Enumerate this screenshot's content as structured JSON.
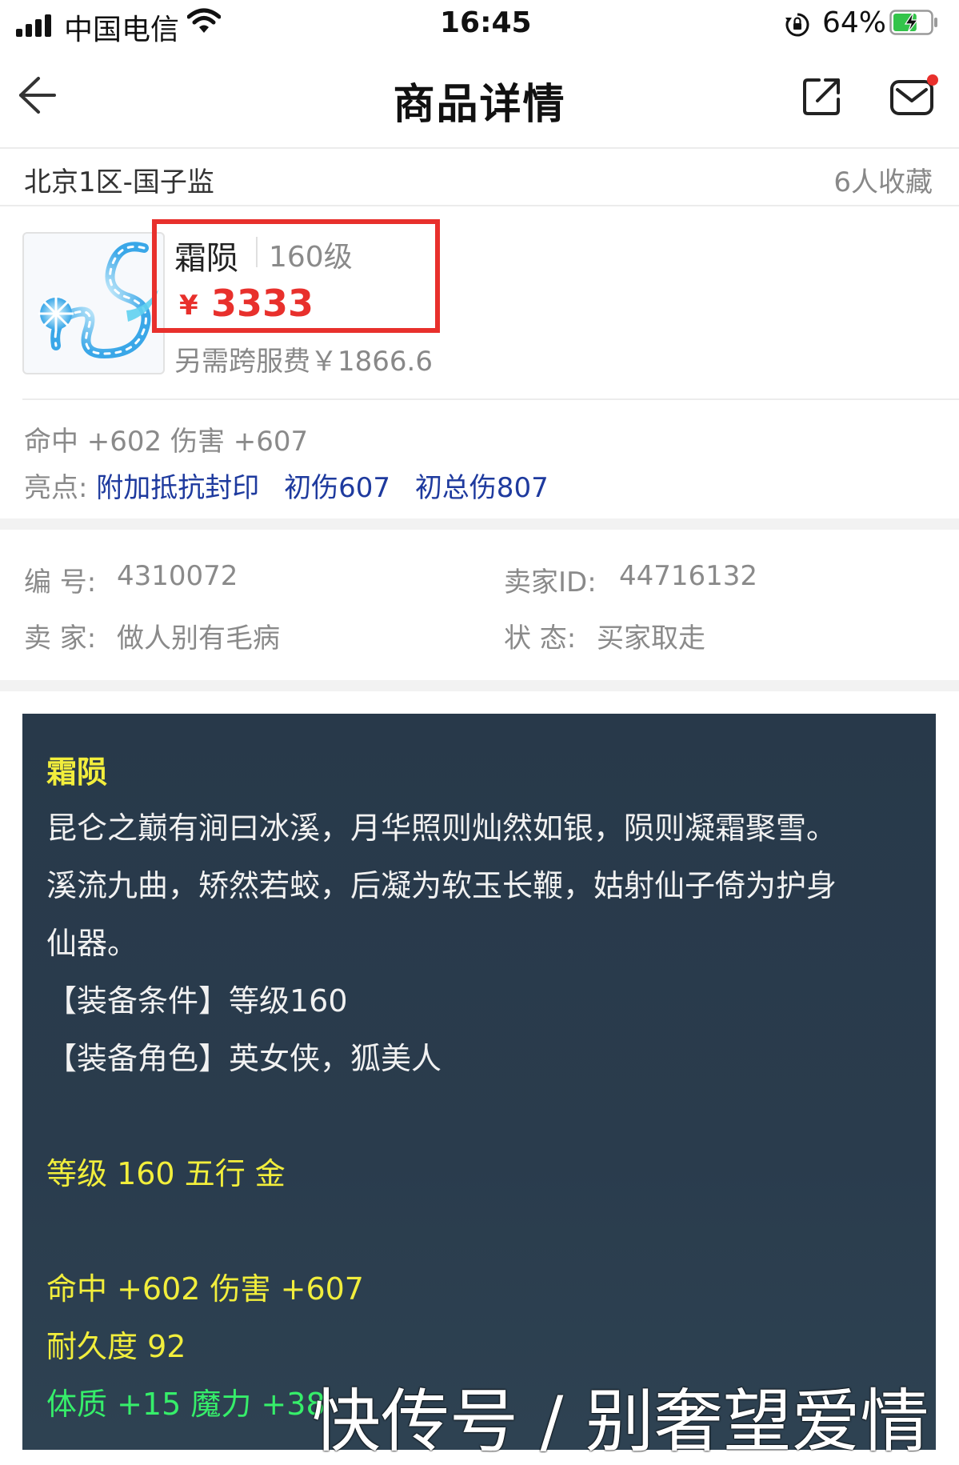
{
  "status_bar": {
    "carrier": "中国电信",
    "time": "16:45",
    "battery_pct": "64%",
    "battery_level": 0.64
  },
  "nav": {
    "title": "商品详情"
  },
  "listing": {
    "server": "北京1区-国子监",
    "favorites": "6人收藏",
    "item_name": "霜陨",
    "item_level": "160级",
    "price_currency": "¥",
    "price": "3333",
    "cross_server_fee": "另需跨服费￥1866.6",
    "stats": "命中 +602 伤害 +607",
    "highlights_label": "亮点:",
    "highlights": [
      "附加抵抗封印",
      "初伤607",
      "初总伤807"
    ]
  },
  "info": {
    "id_label": "编 号:",
    "id_value": "4310072",
    "seller_id_label": "卖家ID:",
    "seller_id_value": "44716132",
    "seller_label": "卖 家:",
    "seller_value": "做人别有毛病",
    "status_label": "状 态:",
    "status_value": "买家取走"
  },
  "description": {
    "name": "霜陨",
    "lore_1": "昆仑之巅有涧曰冰溪，月华照则灿然如银，陨则凝霜聚雪。",
    "lore_2": "溪流九曲，矫然若蛟，后凝为软玉长鞭，姑射仙子倚为护身",
    "lore_3": "仙器。",
    "requirement": "【装备条件】等级160",
    "roles": "【装备角色】英女侠，狐美人",
    "level_element": "等级 160 五行 金",
    "attack": "命中 +602 伤害 +607",
    "durability": "耐久度 92",
    "bonus": "体质 +15 魔力 +38"
  },
  "watermark": "快传号 / 别奢望爱情",
  "colors": {
    "price_red": "#e8302c",
    "highlight_blue": "#1e3a9e",
    "panel_bg": "#28394a",
    "text_yellow": "#f2ee3c",
    "text_green": "#36ee6a"
  },
  "icons": [
    "signal-icon",
    "wifi-icon",
    "rotation-lock-icon",
    "battery-icon",
    "back-arrow-icon",
    "share-icon",
    "mail-icon",
    "item-whip-icon"
  ]
}
